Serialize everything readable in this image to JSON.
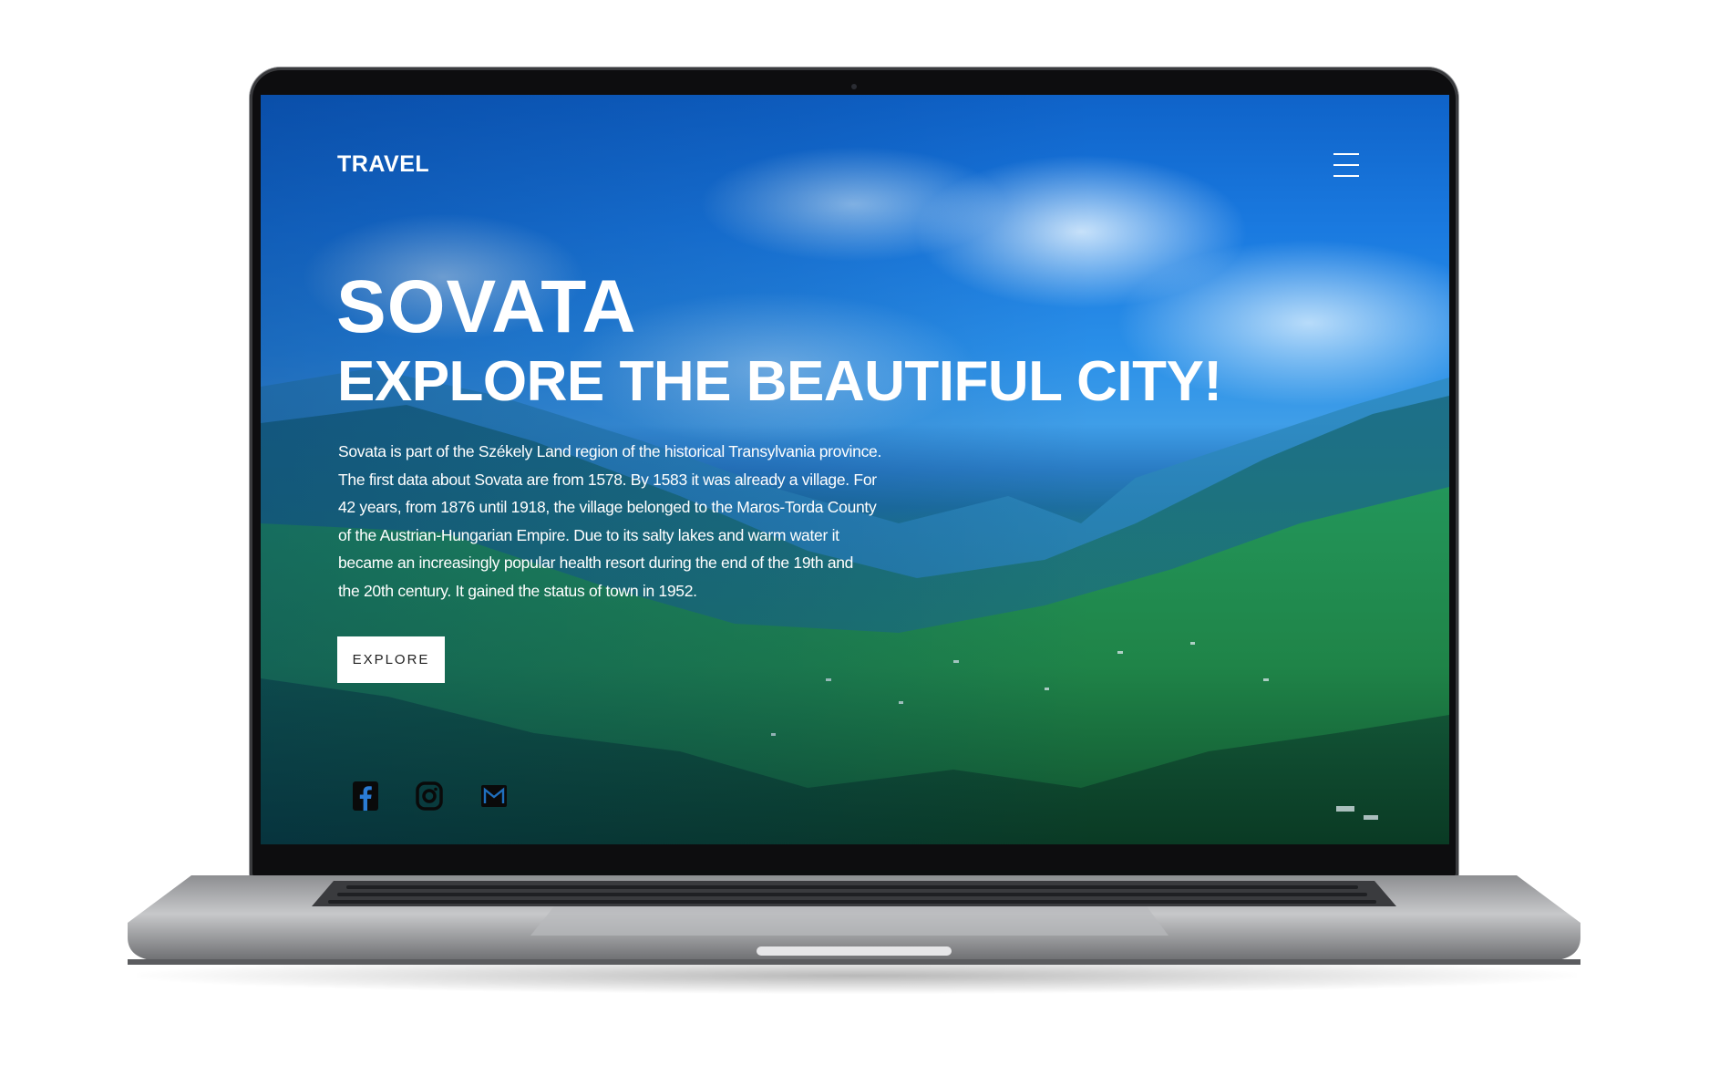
{
  "site": {
    "brand": "TRAVEL",
    "headline": "SOVATA",
    "subheadline": "EXPLORE THE BEAUTIFUL CITY!",
    "paragraph_lines": [
      "Sovata is part of the Székely Land region of the historical Transylvania province.",
      "The first data about Sovata are from 1578. By 1583 it was already a village. For",
      "42 years, from 1876 until 1918, the village belonged to the Maros-Torda County",
      "of the Austrian-Hungarian Empire. Due to its salty lakes and warm water it",
      "became an increasingly popular health resort during the end of the 19th and",
      "the 20th century. It gained the status of town in 1952."
    ],
    "cta_label": "EXPLORE"
  },
  "icons": {
    "menu": "menu-icon",
    "social": [
      "facebook-icon",
      "instagram-icon",
      "mail-icon"
    ]
  },
  "colors": {
    "text": "#ffffff",
    "button_bg": "#ffffff",
    "button_text": "#222222",
    "social_icon": "#0a0a0a",
    "bezel": "#0d0d0f",
    "chassis": "#b9babd"
  }
}
